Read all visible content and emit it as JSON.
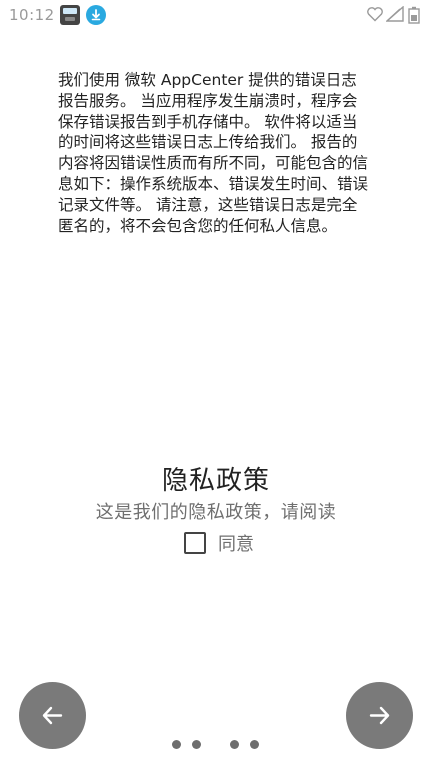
{
  "status_bar": {
    "time": "10:12",
    "icons": [
      "app-notification-icon",
      "download-icon",
      "heart-icon",
      "signal-icon",
      "battery-icon"
    ]
  },
  "privacy": {
    "description": "我们使用 微软 AppCenter 提供的错误日志报告服务。 当应用程序发生崩溃时，程序会保存错误报告到手机存储中。 软件将以适当的时间将这些错误日志上传给我们。 报告的内容将因错误性质而有所不同，可能包含的信息如下：操作系统版本、错误发生时间、错误记录文件等。 请注意，这些错误日志是完全匿名的，将不会包含您的任何私人信息。",
    "title": "隐私政策",
    "subtitle": "这是我们的隐私政策，请阅读",
    "agree_label": "同意",
    "agree_checked": false
  },
  "navigation": {
    "back_icon": "arrow-left-icon",
    "next_icon": "arrow-right-icon",
    "page_count": 4
  },
  "colors": {
    "background": "#ffffff",
    "nav_button": "#7a7a7a",
    "dots": "#6e6e6e",
    "download_icon": "#2aa9e0"
  }
}
